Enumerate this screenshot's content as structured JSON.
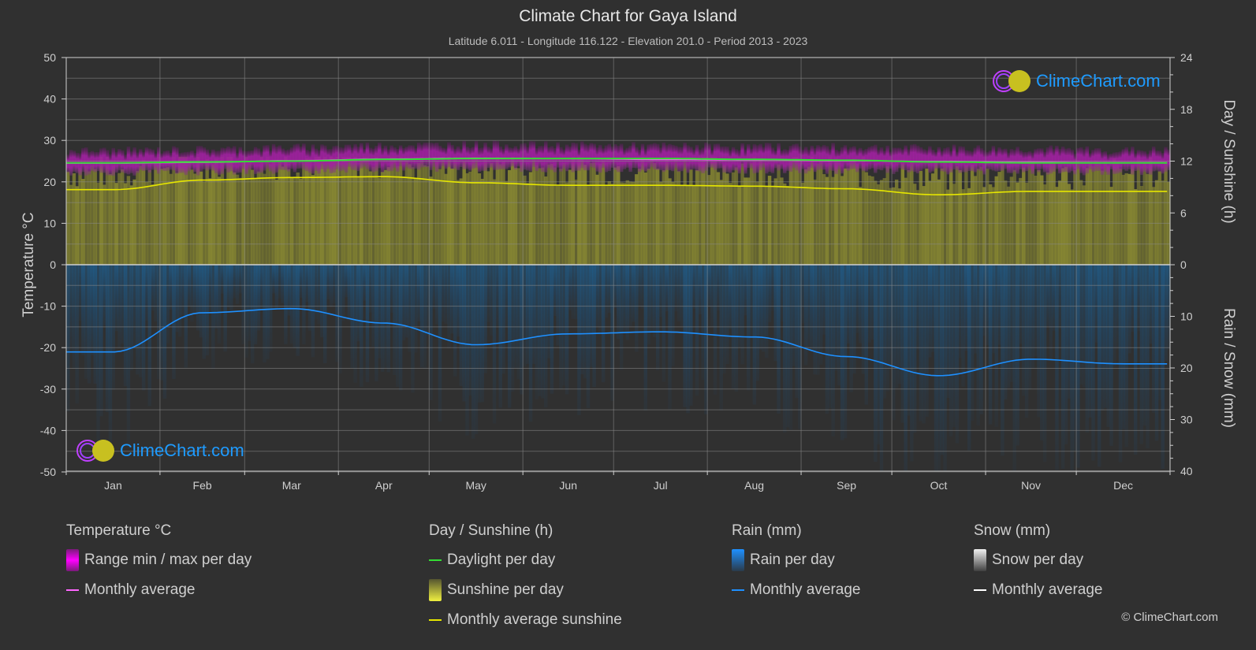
{
  "header": {
    "title": "Climate Chart for Gaya Island",
    "subtitle": "Latitude 6.011 - Longitude 116.122 - Elevation 201.0 - Period 2013 - 2023"
  },
  "branding": {
    "logo_text": "ClimeChart.com",
    "copyright": "© ClimeChart.com"
  },
  "axes": {
    "left_title": "Temperature °C",
    "right_top_title": "Day / Sunshine (h)",
    "right_bottom_title": "Rain / Snow (mm)"
  },
  "legend": {
    "temperature": {
      "title": "Temperature °C",
      "items": [
        {
          "label": "Range min / max per day",
          "kind": "swatch",
          "color": "#e600e6"
        },
        {
          "label": "Monthly average",
          "kind": "line",
          "color": "#ff66ff"
        }
      ]
    },
    "sunshine": {
      "title": "Day / Sunshine (h)",
      "items": [
        {
          "label": "Daylight per day",
          "kind": "line",
          "color": "#33dd33"
        },
        {
          "label": "Sunshine per day",
          "kind": "swatch",
          "color": "#e6e633"
        },
        {
          "label": "Monthly average sunshine",
          "kind": "line",
          "color": "#e6e600"
        }
      ]
    },
    "rain": {
      "title": "Rain (mm)",
      "items": [
        {
          "label": "Rain per day",
          "kind": "swatch",
          "color": "#1e90ff"
        },
        {
          "label": "Monthly average",
          "kind": "line",
          "color": "#1e90ff"
        }
      ]
    },
    "snow": {
      "title": "Snow (mm)",
      "items": [
        {
          "label": "Snow per day",
          "kind": "swatch",
          "color": "#e0e0e0"
        },
        {
          "label": "Monthly average",
          "kind": "line",
          "color": "#ffffff"
        }
      ]
    }
  },
  "chart_data": {
    "type": "line",
    "title": "Climate Chart for Gaya Island",
    "categories": [
      "Jan",
      "Feb",
      "Mar",
      "Apr",
      "May",
      "Jun",
      "Jul",
      "Aug",
      "Sep",
      "Oct",
      "Nov",
      "Dec"
    ],
    "left_axis": {
      "label": "Temperature °C",
      "range": [
        -50,
        50
      ],
      "ticks": [
        50,
        40,
        30,
        20,
        10,
        0,
        -10,
        -20,
        -30,
        -40,
        -50
      ]
    },
    "right_axis_top": {
      "label": "Day / Sunshine (h)",
      "range": [
        0,
        24
      ],
      "ticks": [
        24,
        18,
        12,
        6,
        0
      ]
    },
    "right_axis_bottom": {
      "label": "Rain / Snow (mm)",
      "range": [
        0,
        40
      ],
      "ticks": [
        0,
        10,
        20,
        30,
        40
      ]
    },
    "grid": true,
    "series": [
      {
        "name": "Temperature monthly average (°C)",
        "axis": "left",
        "color": "#ff66ff",
        "values": [
          24.5,
          24.7,
          25.1,
          25.5,
          25.7,
          25.6,
          25.4,
          25.3,
          25.1,
          24.9,
          24.7,
          24.6
        ]
      },
      {
        "name": "Temperature daily max (°C)",
        "axis": "left",
        "color": "#a020a0",
        "values": [
          27.5,
          27.8,
          28.3,
          28.8,
          29.0,
          28.8,
          28.6,
          28.5,
          28.4,
          28.1,
          27.9,
          27.6
        ]
      },
      {
        "name": "Temperature daily min (°C)",
        "axis": "left",
        "color": "#a020a0",
        "values": [
          22.2,
          22.3,
          22.6,
          23.0,
          23.2,
          23.0,
          22.8,
          22.7,
          22.6,
          22.5,
          22.4,
          22.3
        ]
      },
      {
        "name": "Daylight per day (h)",
        "axis": "right_top",
        "color": "#33dd33",
        "values": [
          11.8,
          11.9,
          12.0,
          12.2,
          12.3,
          12.3,
          12.3,
          12.2,
          12.1,
          11.9,
          11.8,
          11.8
        ]
      },
      {
        "name": "Monthly average sunshine (h)",
        "axis": "right_top",
        "color": "#e6e600",
        "values": [
          8.7,
          9.8,
          10.1,
          10.2,
          9.5,
          9.2,
          9.2,
          9.1,
          8.8,
          8.1,
          8.5,
          8.5
        ]
      },
      {
        "name": "Rain monthly average (mm)",
        "axis": "right_bottom",
        "color": "#1e90ff",
        "values": [
          16.9,
          9.3,
          8.5,
          11.3,
          15.5,
          13.4,
          13.0,
          14.0,
          17.8,
          21.5,
          18.3,
          19.2
        ]
      },
      {
        "name": "Snow monthly average (mm)",
        "axis": "right_bottom",
        "color": "#ffffff",
        "values": [
          0,
          0,
          0,
          0,
          0,
          0,
          0,
          0,
          0,
          0,
          0,
          0
        ]
      }
    ]
  }
}
